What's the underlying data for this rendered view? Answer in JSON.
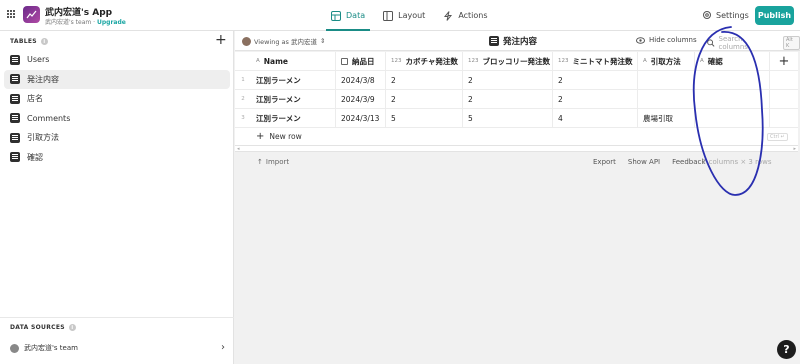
{
  "app": {
    "title": "武内宏道's App",
    "team": "武内宏道's team",
    "sep": "·",
    "upgrade": "Upgrade"
  },
  "nav": {
    "tabs": [
      {
        "label": "Data",
        "active": true
      },
      {
        "label": "Layout"
      },
      {
        "label": "Actions"
      }
    ],
    "settings_label": "Settings",
    "publish_label": "Publish"
  },
  "sidebar": {
    "tables_heading": "TABLES",
    "items": [
      {
        "label": "Users"
      },
      {
        "label": "発注内容",
        "active": true
      },
      {
        "label": "店名"
      },
      {
        "label": "Comments"
      },
      {
        "label": "引取方法"
      },
      {
        "label": "確認"
      }
    ],
    "datasources_heading": "DATA SOURCES",
    "datasource": "武内宏道's team"
  },
  "toolbar": {
    "viewing_label": "Viewing as 武内宏道",
    "table_title": "発注内容",
    "hide_columns": "Hide columns",
    "search_placeholder": "Search columns",
    "search_shortcut": "Alt K"
  },
  "table": {
    "columns": [
      {
        "type": "A",
        "label": "Name"
      },
      {
        "type": "date",
        "label": "納品日"
      },
      {
        "type": "123",
        "label": "カボチャ発注数"
      },
      {
        "type": "123",
        "label": "ブロッコリー発注数"
      },
      {
        "type": "123",
        "label": "ミニトマト発注数"
      },
      {
        "type": "A",
        "label": "引取方法"
      },
      {
        "type": "A",
        "label": "確認"
      }
    ],
    "rows": [
      {
        "index": "1",
        "cells": [
          "江別ラーメン",
          "2024/3/8",
          "2",
          "2",
          "2",
          "",
          ""
        ]
      },
      {
        "index": "2",
        "cells": [
          "江別ラーメン",
          "2024/3/9",
          "2",
          "2",
          "2",
          "",
          ""
        ]
      },
      {
        "index": "3",
        "cells": [
          "江別ラーメン",
          "2024/3/13",
          "5",
          "5",
          "4",
          "農場引取",
          ""
        ]
      }
    ],
    "new_row_label": "New row",
    "new_row_shortcut": "Ctrl ↵"
  },
  "footer": {
    "import_label": "Import",
    "export_label": "Export",
    "show_api_label": "Show API",
    "feedback_label": "Feedback",
    "summary": "7 columns × 3 rows"
  },
  "help_label": "?",
  "colors": {
    "accent": "#19a39d",
    "annotation": "#2a2fb0"
  }
}
